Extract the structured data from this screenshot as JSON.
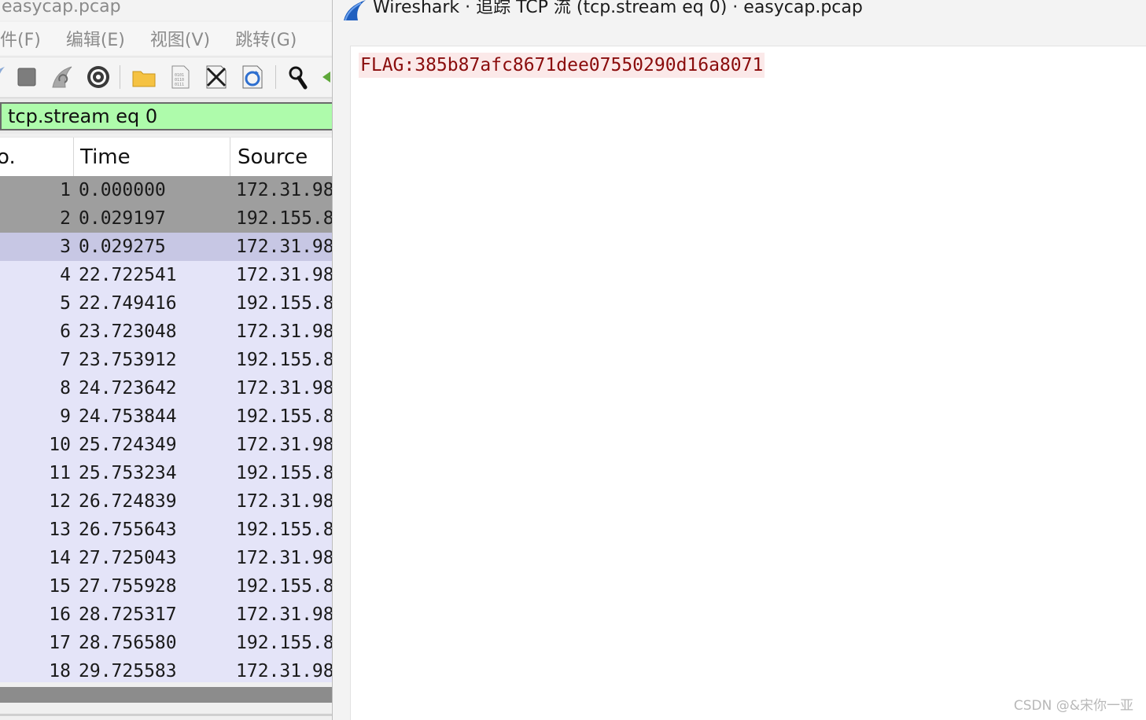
{
  "main_window": {
    "title": "easycap.pcap",
    "menu": [
      {
        "label": "文件(F)",
        "display": "件(F)"
      },
      {
        "label": "编辑(E)",
        "display": "编辑(E)"
      },
      {
        "label": "视图(V)",
        "display": "视图(V)"
      },
      {
        "label": "跳转(G)",
        "display": "跳转(G)"
      }
    ],
    "toolbar": {
      "icons": [
        "start-capture-icon",
        "stop-capture-icon",
        "restart-capture-icon",
        "capture-options-icon",
        "open-file-icon",
        "save-file-icon",
        "close-file-icon",
        "reload-file-icon",
        "find-packet-icon",
        "go-back-icon"
      ]
    },
    "display_filter": "tcp.stream eq 0",
    "columns": {
      "no": "o.",
      "time": "Time",
      "source": "Source"
    },
    "packets": [
      {
        "no": "1",
        "time": "0.000000",
        "source": "172.31.98",
        "state": "marked"
      },
      {
        "no": "2",
        "time": "0.029197",
        "source": "192.155.8",
        "state": "marked"
      },
      {
        "no": "3",
        "time": "0.029275",
        "source": "172.31.98",
        "state": "selected"
      },
      {
        "no": "4",
        "time": "22.722541",
        "source": "172.31.98",
        "state": "normal"
      },
      {
        "no": "5",
        "time": "22.749416",
        "source": "192.155.8",
        "state": "normal"
      },
      {
        "no": "6",
        "time": "23.723048",
        "source": "172.31.98",
        "state": "normal"
      },
      {
        "no": "7",
        "time": "23.753912",
        "source": "192.155.8",
        "state": "normal"
      },
      {
        "no": "8",
        "time": "24.723642",
        "source": "172.31.98",
        "state": "normal"
      },
      {
        "no": "9",
        "time": "24.753844",
        "source": "192.155.8",
        "state": "normal"
      },
      {
        "no": "10",
        "time": "25.724349",
        "source": "172.31.98",
        "state": "normal"
      },
      {
        "no": "11",
        "time": "25.753234",
        "source": "192.155.8",
        "state": "normal"
      },
      {
        "no": "12",
        "time": "26.724839",
        "source": "172.31.98",
        "state": "normal"
      },
      {
        "no": "13",
        "time": "26.755643",
        "source": "192.155.8",
        "state": "normal"
      },
      {
        "no": "14",
        "time": "27.725043",
        "source": "172.31.98",
        "state": "normal"
      },
      {
        "no": "15",
        "time": "27.755928",
        "source": "192.155.8",
        "state": "normal"
      },
      {
        "no": "16",
        "time": "28.725317",
        "source": "172.31.98",
        "state": "normal"
      },
      {
        "no": "17",
        "time": "28.756580",
        "source": "192.155.8",
        "state": "normal"
      },
      {
        "no": "18",
        "time": "29.725583",
        "source": "172.31.98",
        "state": "normal"
      }
    ],
    "colors": {
      "marked_row": "#9e9e9e",
      "selected_row": "#c7c7e4",
      "normal_row": "#e4e4f8",
      "filter_valid": "#aefbab"
    }
  },
  "stream_window": {
    "title": "Wireshark · 追踪 TCP 流 (tcp.stream eq 0) · easycap.pcap",
    "content": "FLAG:385b87afc8671dee07550290d16a8071",
    "colors": {
      "client_text": "#8a0c0c",
      "client_bg": "#fbe9e9"
    }
  },
  "watermark": "CSDN @&宋你一亚"
}
